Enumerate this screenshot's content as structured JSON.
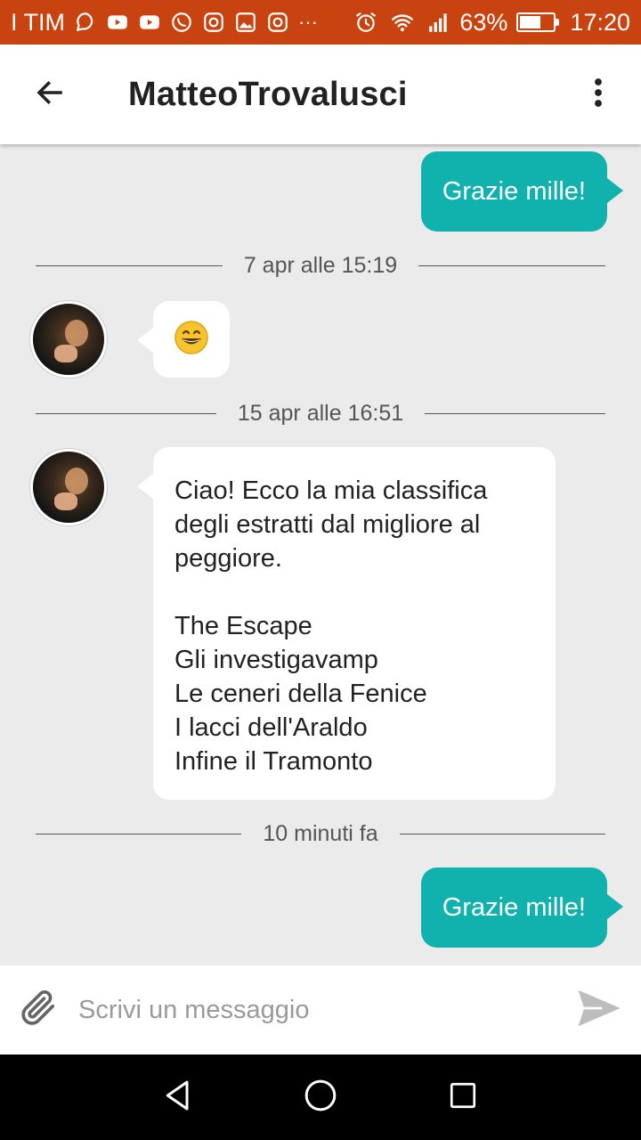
{
  "status_bar": {
    "carrier": "I TIM",
    "battery": "63%",
    "battery_level": 0.63,
    "time": "17:20",
    "ellipsis": "···"
  },
  "header": {
    "title": "MatteoTrovalusci"
  },
  "messages": [
    {
      "type": "outgoing",
      "text": "Grazie mille!"
    },
    {
      "type": "divider",
      "text": "7 apr alle 15:19"
    },
    {
      "type": "incoming_emoji",
      "emoji": "grinning-face"
    },
    {
      "type": "divider",
      "text": "15 apr alle 16:51"
    },
    {
      "type": "incoming",
      "lines": [
        "Ciao! Ecco la mia classifica",
        "degli estratti dal migliore al",
        "peggiore.",
        "",
        "The Escape",
        "Gli investigavamp",
        "Le ceneri della Fenice",
        "I lacci dell'Araldo",
        "Infine il Tramonto"
      ]
    },
    {
      "type": "divider",
      "text": "10 minuti fa"
    },
    {
      "type": "outgoing",
      "text": "Grazie mille!"
    }
  ],
  "input": {
    "placeholder": "Scrivi un messaggio",
    "value": ""
  },
  "colors": {
    "status_bar": "#c8430f",
    "outgoing_bubble": "#11b2ad",
    "chat_background": "#ebebeb"
  },
  "icons": {
    "back": "arrow-left-icon",
    "menu": "more-vert-icon",
    "attach": "paperclip-icon",
    "send": "send-icon",
    "nav_back": "triangle-back-icon",
    "nav_home": "circle-home-icon",
    "nav_recents": "square-recents-icon"
  }
}
